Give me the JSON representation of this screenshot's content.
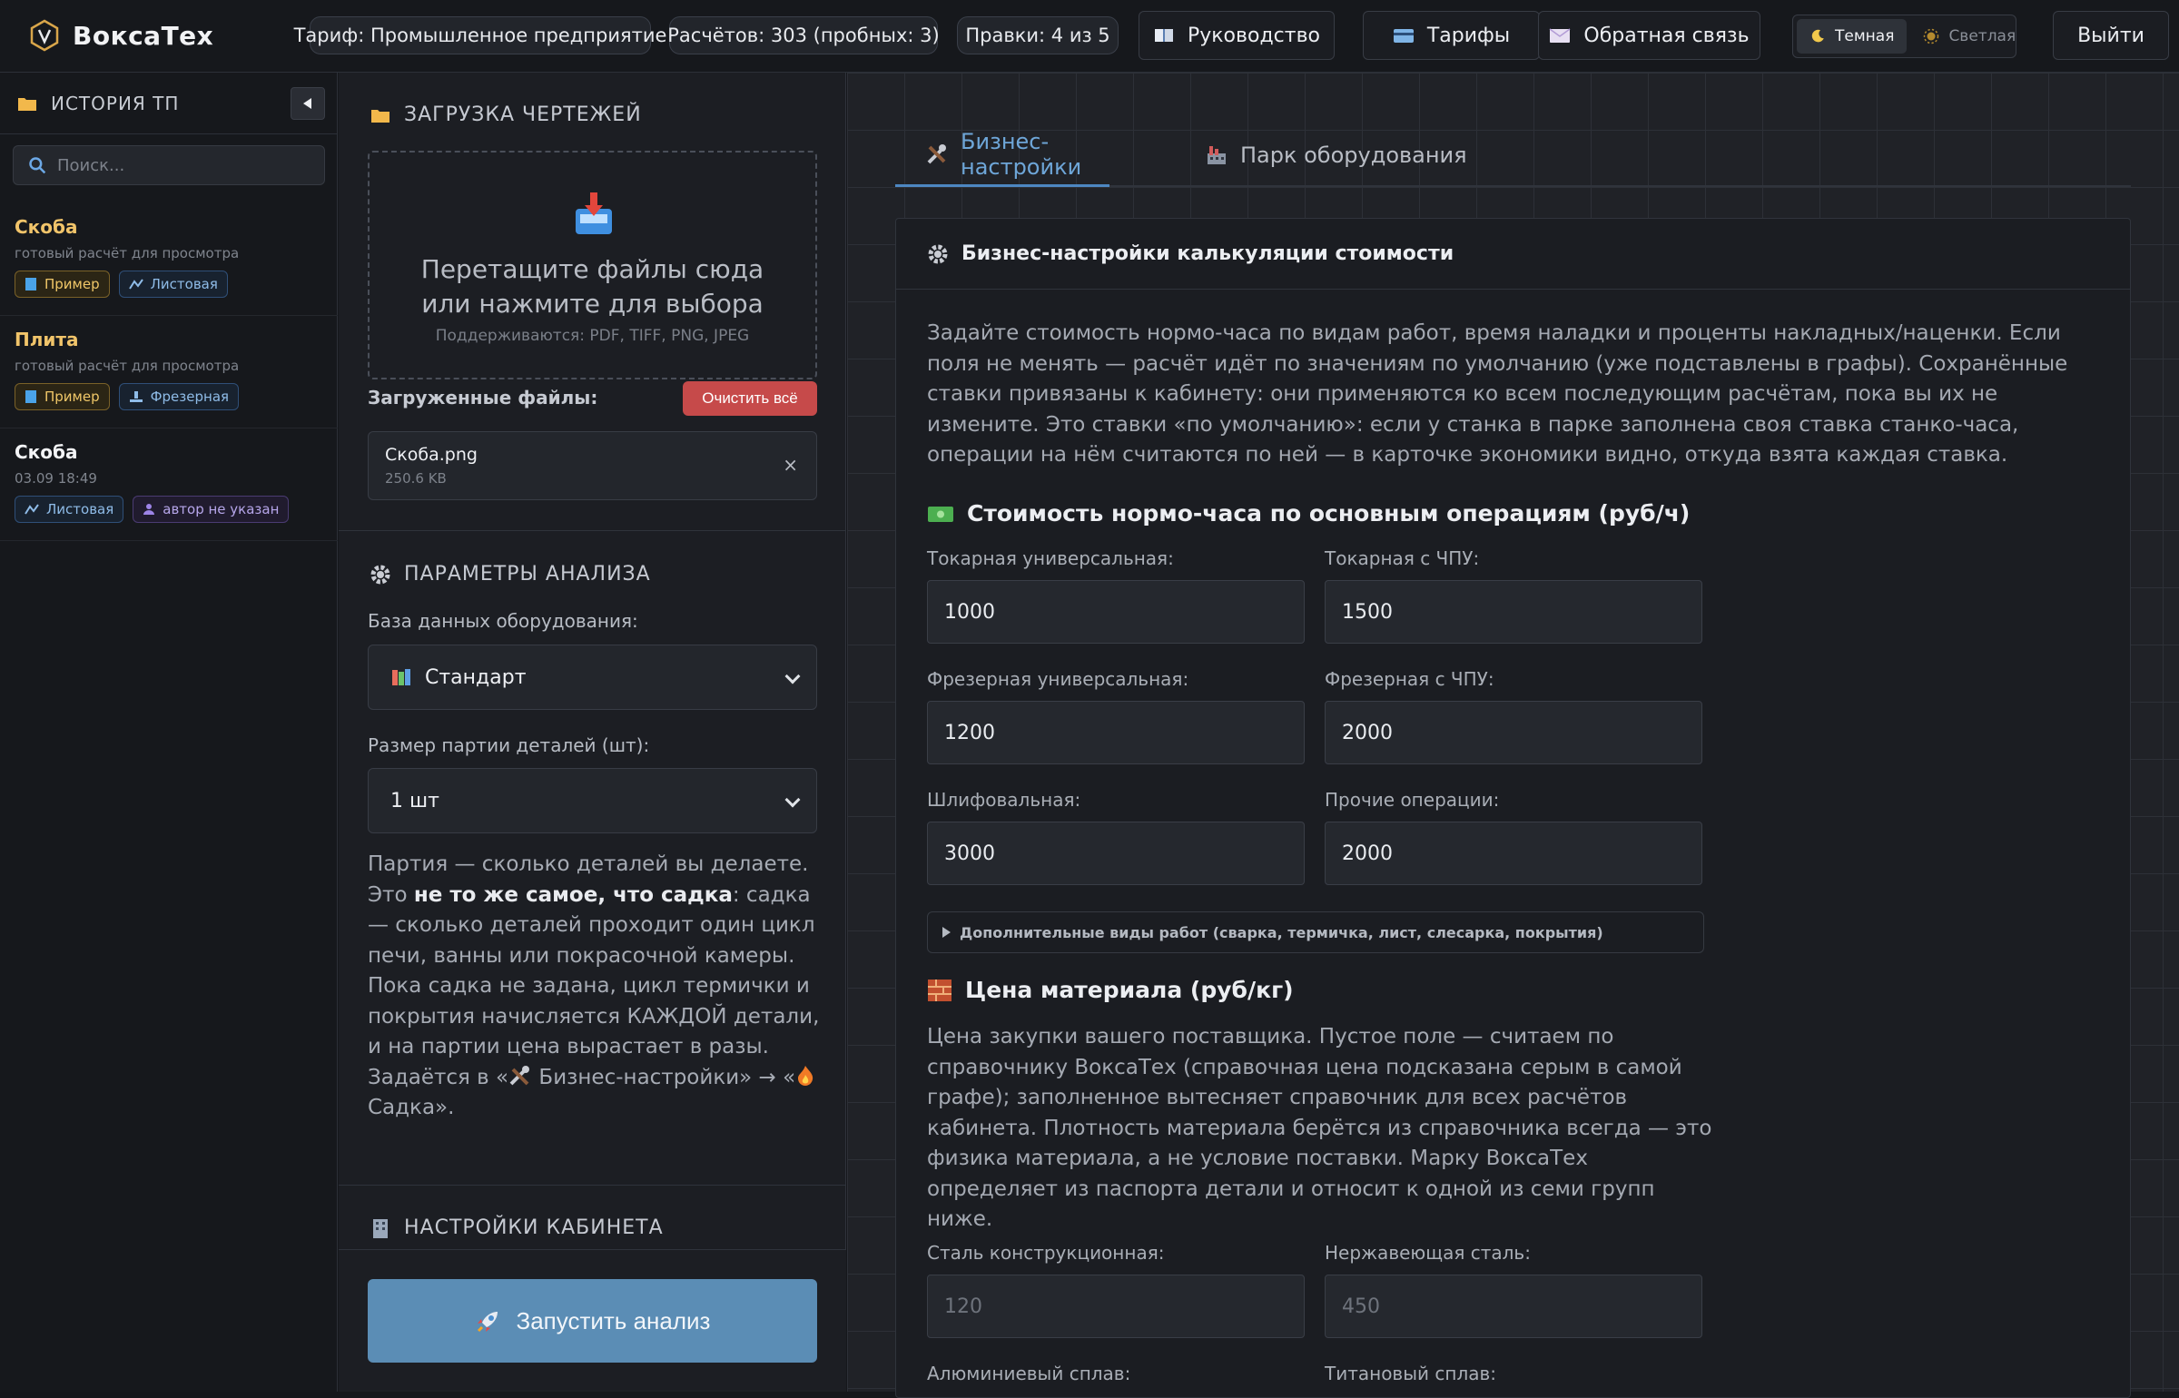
{
  "app": {
    "name": "ВоксаТех"
  },
  "topbar": {
    "tariff": "Тариф: Промышленное предприятие",
    "calcs": "Расчётов: 303 (пробных: 3)",
    "edits": "Правки: 4 из 5",
    "guide": "Руководство",
    "tariffs": "Тарифы",
    "feedback": "Обратная связь",
    "theme_dark": "Темная",
    "theme_light": "Светлая",
    "logout": "Выйти"
  },
  "sidebar": {
    "title": "ИСТОРИЯ ТП",
    "search_placeholder": "Поиск...",
    "items": [
      {
        "title": "Скоба",
        "sub": "готовый расчёт для просмотра",
        "tags": [
          "Пример",
          "Листовая"
        ]
      },
      {
        "title": "Плита",
        "sub": "готовый расчёт для просмотра",
        "tags": [
          "Пример",
          "Фрезерная"
        ]
      },
      {
        "title": "Скоба",
        "sub": "03.09 18:49",
        "tags": [
          "Листовая",
          "автор не указан"
        ]
      }
    ]
  },
  "upload": {
    "title": "ЗАГРУЗКА ЧЕРТЕЖЕЙ",
    "drop_text": "Перетащите файлы сюда или нажмите для выбора",
    "supported": "Поддерживаются: PDF, TIFF, PNG, JPEG",
    "loaded_label": "Загруженные файлы:",
    "clear": "Очистить всё",
    "file": {
      "name": "Скоба.png",
      "size": "250.6 KB"
    }
  },
  "analysis": {
    "title": "ПАРАМЕТРЫ АНАЛИЗА",
    "db_label": "База данных оборудования:",
    "db_value": "Стандарт",
    "batch_label": "Размер партии деталей (шт):",
    "batch_value": "1 шт",
    "note_1": "Партия — сколько деталей вы делаете. Это ",
    "note_bold": "не то же самое, что садка",
    "note_2": ": садка — сколько деталей проходит один цикл печи, ванны или покрасочной камеры. Пока садка не задана, цикл термички и покрытия начисляется КАЖДОЙ детали, и на партии цена вырастает в разы. Задаётся в «",
    "note_link1": " Бизнес-настройки» → «",
    "note_link2": " Садка»."
  },
  "cabinet": {
    "title": "НАСТРОЙКИ КАБИНЕТА"
  },
  "run": {
    "label": "Запустить анализ"
  },
  "tabs": {
    "business": "Бизнес-настройки",
    "park": "Парк оборудования"
  },
  "panel": {
    "title": "Бизнес-настройки калькуляции стоимости",
    "desc": "Задайте стоимость нормо-часа по видам работ, время наладки и проценты накладных/наценки. Если поля не менять — расчёт идёт по значениям по умолчанию (уже подставлены в графы). Сохранённые ставки привязаны к кабинету: они применяются ко всем последующим расчётам, пока вы их не измените. Это ставки «по умолчанию»: если у станка в парке заполнена своя ставка станко-часа, операции на нём считаются по ней — в карточке экономики видно, откуда взята каждая ставка.",
    "rates_title": "Стоимость нормо-часа по основным операциям (руб/ч)",
    "rates": [
      {
        "label": "Токарная универсальная:",
        "value": "1000"
      },
      {
        "label": "Токарная с ЧПУ:",
        "value": "1500"
      },
      {
        "label": "Фрезерная универсальная:",
        "value": "1200"
      },
      {
        "label": "Фрезерная с ЧПУ:",
        "value": "2000"
      },
      {
        "label": "Шлифовальная:",
        "value": "3000"
      },
      {
        "label": "Прочие операции:",
        "value": "2000"
      }
    ],
    "extra": "Дополнительные виды работ (сварка, термичка, лист, слесарка, покрытия)",
    "material_title": "Цена материала (руб/кг)",
    "material_desc": "Цена закупки вашего поставщика. Пустое поле — считаем по справочнику ВоксаТех (справочная цена подсказана серым в самой графе); заполненное вытесняет справочник для всех расчётов кабинета. Плотность материала берётся из справочника всегда — это физика материала, а не условие поставки. Марку ВоксаТех определяет из паспорта детали и относит к одной из семи групп ниже.",
    "materials": [
      {
        "label": "Сталь конструкционная:",
        "placeholder": "120"
      },
      {
        "label": "Нержавеющая сталь:",
        "placeholder": "450"
      },
      {
        "label": "Алюминиевый сплав:",
        "placeholder": ""
      },
      {
        "label": "Титановый сплав:",
        "placeholder": ""
      }
    ]
  }
}
